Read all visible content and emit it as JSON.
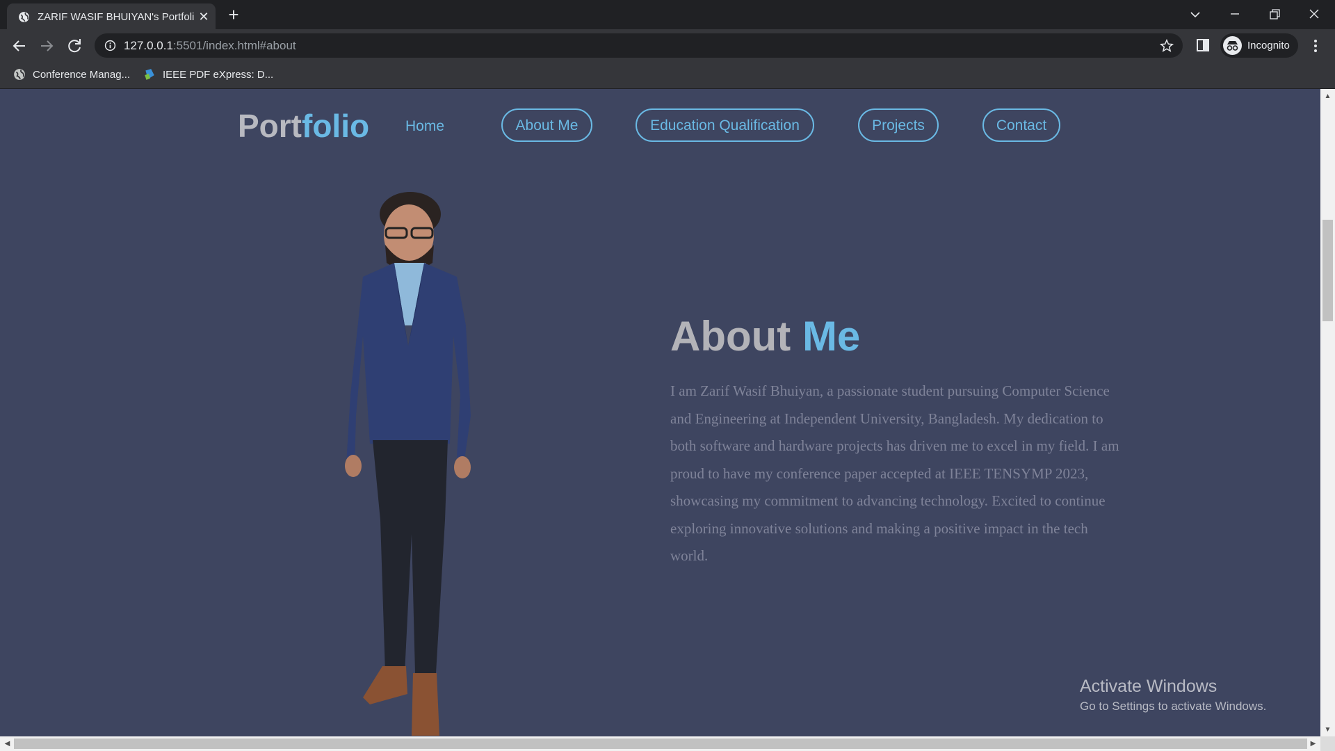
{
  "browser": {
    "tab_title": "ZARIF WASIF BHUIYAN's Portfolio",
    "tab_close": "✕",
    "new_tab": "+",
    "url_host": "127.0.0.1",
    "url_rest": ":5501/index.html#about",
    "profile_label": "Incognito",
    "bookmarks": [
      {
        "label": "Conference Manag..."
      },
      {
        "label": "IEEE PDF eXpress: D..."
      }
    ]
  },
  "site": {
    "logo_main": "Port",
    "logo_accent": "folio",
    "nav": {
      "home": "Home",
      "about": "About Me",
      "education": "Education Qualification",
      "projects": "Projects",
      "contact": "Contact"
    },
    "about": {
      "title_main": "About ",
      "title_accent": "Me",
      "text": "I am Zarif Wasif Bhuiyan, a passionate student pursuing Computer Science and Engineering at Independent University, Bangladesh. My dedication to both software and hardware projects has driven me to excel in my field. I am proud to have my conference paper accepted at IEEE TENSYMP 2023, showcasing my commitment to advancing technology. Excited to continue exploring innovative solutions and making a positive impact in the tech world."
    }
  },
  "os_watermark": {
    "title": "Activate Windows",
    "subtitle": "Go to Settings to activate Windows."
  },
  "colors": {
    "accent": "#6ab9e4",
    "page_bg": "#3e4560",
    "logo_grey": "#b8b9c0"
  }
}
